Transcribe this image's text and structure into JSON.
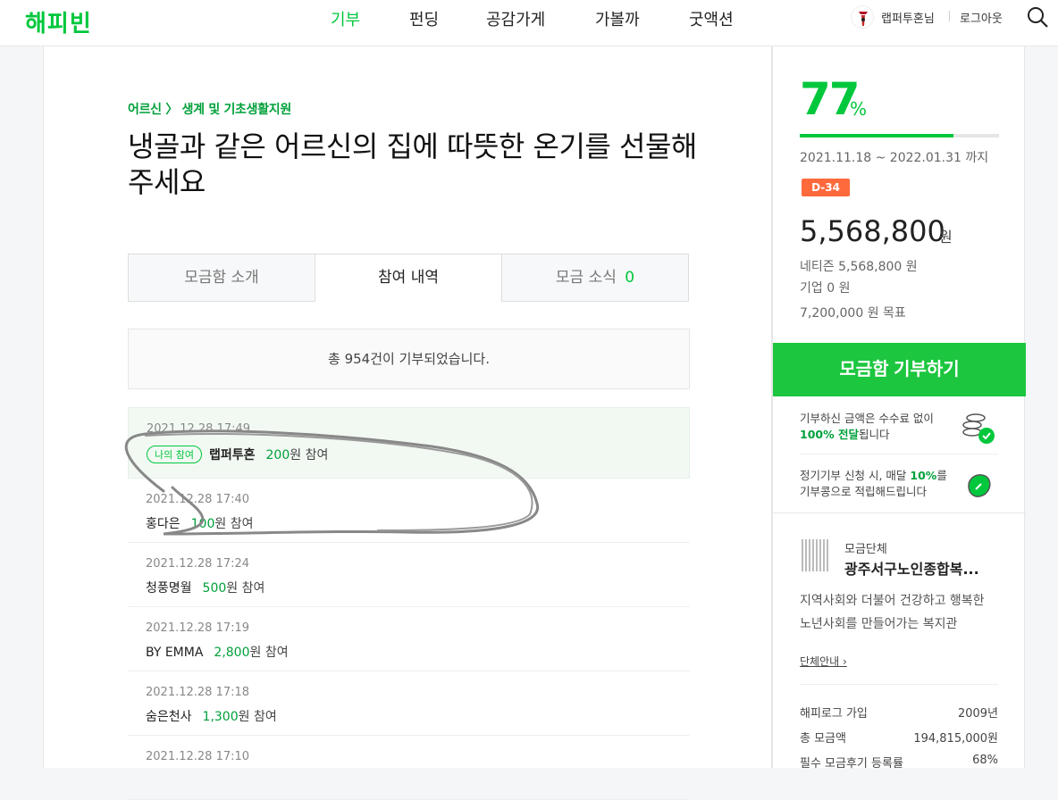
{
  "header": {
    "logo": "해피빈",
    "nav": [
      "기부",
      "펀딩",
      "공감가게",
      "가볼까",
      "굿액션"
    ],
    "active_nav": "기부",
    "user": "랩퍼투혼님",
    "logout": "로그아웃"
  },
  "campaign": {
    "category": "어르신 〉 생계 및 기초생활지원",
    "title": "냉골과 같은 어르신의 집에 따뜻한 온기를 선물해주세요",
    "tabs": [
      {
        "label": "모금함 소개",
        "count": ""
      },
      {
        "label": "참여 내역",
        "count": ""
      },
      {
        "label": "모금 소식",
        "count": "0"
      }
    ],
    "summary": "총 954건이 기부되었습니다."
  },
  "donations": [
    {
      "date": "2021.12.28 17:49",
      "badge": "나의 참여",
      "name": "랩퍼투혼",
      "amount": "200",
      "unit": "원 참여"
    },
    {
      "date": "2021.12.28 17:40",
      "badge": "",
      "name": "홍다은",
      "amount": "100",
      "unit": "원 참여"
    },
    {
      "date": "2021.12.28 17:24",
      "badge": "",
      "name": "청풍명월",
      "amount": "500",
      "unit": "원 참여"
    },
    {
      "date": "2021.12.28 17:19",
      "badge": "",
      "name": "BY EMMA",
      "amount": "2,800",
      "unit": "원 참여"
    },
    {
      "date": "2021.12.28 17:18",
      "badge": "",
      "name": "숨은천사",
      "amount": "1,300",
      "unit": "원 참여"
    },
    {
      "date": "2021.12.28 17:10",
      "badge": "",
      "name": "",
      "amount": "",
      "unit": ""
    }
  ],
  "sidebar": {
    "percent": "77",
    "percent_unit": "%",
    "progress": 0.77,
    "period": "2021.11.18 ~ 2022.01.31 까지",
    "dday": "D-34",
    "amount": "5,568,800",
    "amount_unit": "원",
    "netizen": "네티즌 5,568,800 원",
    "company": "기업 0 원",
    "goal": "7,200,000 원 목표",
    "donate_button": "모금함 기부하기",
    "info1_a": "기부하신 금액은 수수료 없이",
    "info1_b": "100% 전달",
    "info1_c": "됩니다",
    "info2_a": "정기기부 신청 시, 매달",
    "info2_b": "10%",
    "info2_c": "를",
    "info2_d": "기부콩으로 적립해드립니다",
    "org_label": "모금단체",
    "org_name": "광주서구노인종합복...",
    "org_desc": "지역사회와 더불어 건강하고 행복한 노년사회를 만들어가는 복지관",
    "org_link": "단체안내 ›",
    "stats": [
      {
        "k": "해피로그 가입",
        "v": "2009년"
      },
      {
        "k": "총 모금액",
        "v": "194,815,000원"
      },
      {
        "k": "필수 모금후기 등록률",
        "v": "68%"
      }
    ]
  },
  "colors": {
    "brand": "#00c73c",
    "dday": "#ff6a3d",
    "button": "#1cc63f"
  }
}
